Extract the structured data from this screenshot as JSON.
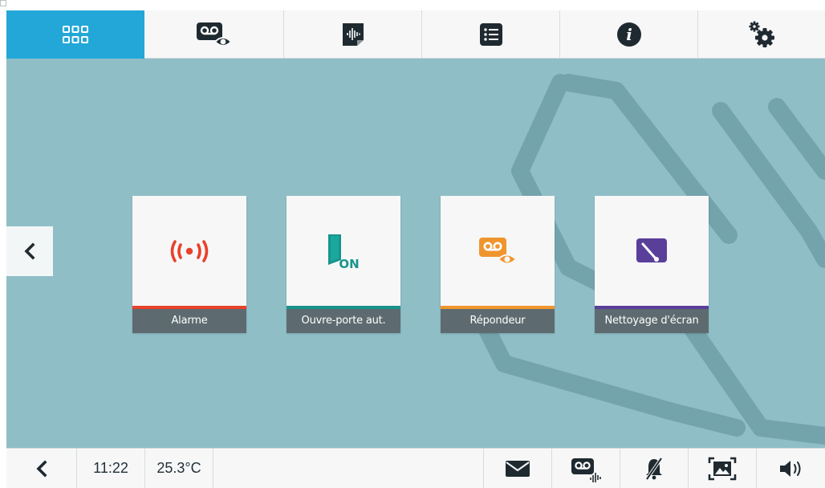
{
  "topbar": {
    "tabs": [
      {
        "id": "home",
        "icon": "grid-icon",
        "active": true
      },
      {
        "id": "answering-machine",
        "icon": "voicemail-eye-icon",
        "active": false
      },
      {
        "id": "audio-notes",
        "icon": "audio-file-icon",
        "active": false
      },
      {
        "id": "list",
        "icon": "list-icon",
        "active": false
      },
      {
        "id": "info",
        "icon": "info-icon",
        "active": false
      },
      {
        "id": "settings",
        "icon": "gears-icon",
        "active": false
      }
    ]
  },
  "tiles": [
    {
      "label": "Alarme",
      "icon": "alarm-broadcast-icon",
      "accent": "#e8412c"
    },
    {
      "label": "Ouvre-porte aut.",
      "icon": "door-on-icon",
      "accent": "#17948a"
    },
    {
      "label": "Répondeur",
      "icon": "voicemail-eye-icon",
      "accent": "#f0952d"
    },
    {
      "label": "Nettoyage d'écran",
      "icon": "screen-clean-icon",
      "accent": "#5a3f9a"
    }
  ],
  "status": {
    "time": "11:22",
    "temperature": "25.3°C"
  },
  "colors": {
    "background": "#8fbec6",
    "active_tab": "#22a7d8",
    "caption": "#5d6b70"
  }
}
